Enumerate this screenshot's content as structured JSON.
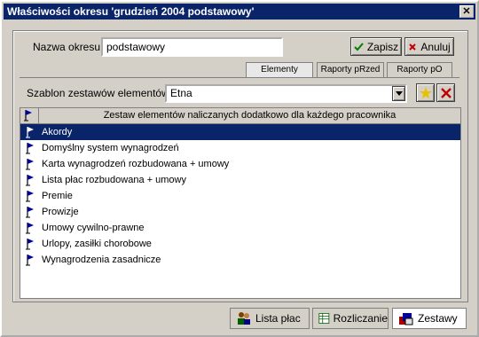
{
  "window": {
    "title": "Właściwości okresu 'grudzień 2004 podstawowy'",
    "close": "✕"
  },
  "header": {
    "name_label": "Nazwa okresu:",
    "name_value": "podstawowy",
    "save_label": "Zapisz",
    "cancel_label": "Anuluj"
  },
  "tabs": [
    {
      "label": "Elementy",
      "active": true
    },
    {
      "label": "Raporty pRzed",
      "active": false
    },
    {
      "label": "Raporty pO",
      "active": false
    }
  ],
  "template": {
    "label": "Szablon zestawów elementów:",
    "value": "Etna"
  },
  "list": {
    "header": "Zestaw elementów naliczanych dodatkowo dla każdego pracownika",
    "items": [
      "Akordy",
      "Domyślny system wynagrodzeń",
      "Karta wynagrodzeń rozbudowana + umowy",
      "Lista płac rozbudowana + umowy",
      "Premie",
      "Prowizje",
      "Umowy cywilno-prawne",
      "Urlopy, zasiłki chorobowe",
      "Wynagrodzenia zasadnicze"
    ],
    "selected_index": 0
  },
  "bottom_tabs": [
    {
      "label": "Lista płac",
      "icon": "people-icon"
    },
    {
      "label": "Rozliczanie",
      "icon": "spreadsheet-icon"
    },
    {
      "label": "Zestawy",
      "icon": "sets-icon",
      "active": true
    }
  ],
  "colors": {
    "title_bg": "#0a246a",
    "selected_row": "#0a246a",
    "face": "#d4d0c8"
  }
}
